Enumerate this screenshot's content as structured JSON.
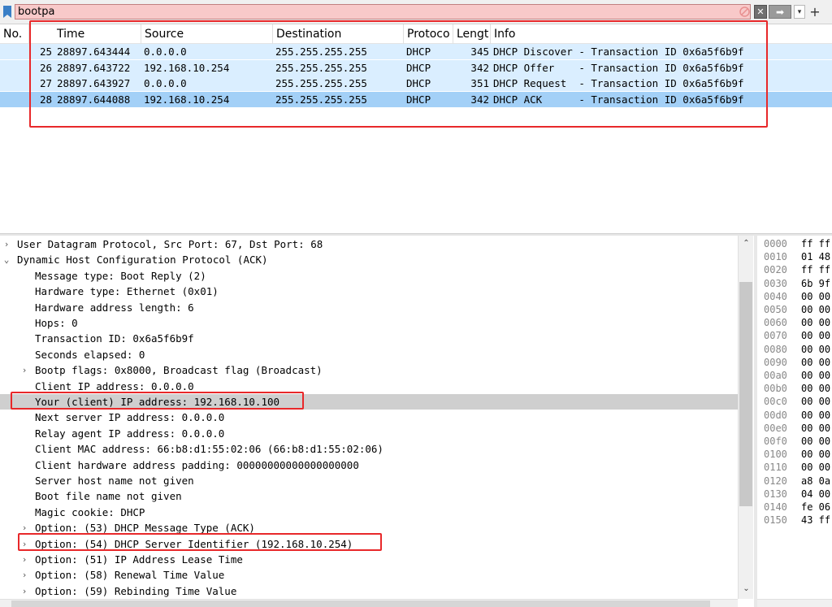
{
  "filter": {
    "text": "bootpa",
    "icons": {
      "bookmark": "bookmark-icon",
      "clear": "clear-filter-icon",
      "close": "close-icon",
      "apply": "arrow-right-icon",
      "dropdown": "chevron-down-icon",
      "add": "plus-icon"
    },
    "close_glyph": "✕",
    "apply_glyph": "➡",
    "dropdown_glyph": "▾",
    "add_glyph": "+"
  },
  "packet_list": {
    "columns": [
      "No.",
      "Time",
      "Source",
      "Destination",
      "Protoco",
      "Lengt",
      "Info"
    ],
    "rows": [
      {
        "no": "25",
        "time": "28897.643444",
        "src": "0.0.0.0",
        "dst": "255.255.255.255",
        "proto": "DHCP",
        "len": "345",
        "info": "DHCP Discover - Transaction ID 0x6a5f6b9f"
      },
      {
        "no": "26",
        "time": "28897.643722",
        "src": "192.168.10.254",
        "dst": "255.255.255.255",
        "proto": "DHCP",
        "len": "342",
        "info": "DHCP Offer    - Transaction ID 0x6a5f6b9f"
      },
      {
        "no": "27",
        "time": "28897.643927",
        "src": "0.0.0.0",
        "dst": "255.255.255.255",
        "proto": "DHCP",
        "len": "351",
        "info": "DHCP Request  - Transaction ID 0x6a5f6b9f"
      },
      {
        "no": "28",
        "time": "28897.644088",
        "src": "192.168.10.254",
        "dst": "255.255.255.255",
        "proto": "DHCP",
        "len": "342",
        "info": "DHCP ACK      - Transaction ID 0x6a5f6b9f"
      }
    ],
    "selected_no": "28"
  },
  "details": {
    "lines": [
      {
        "text": "User Datagram Protocol, Src Port: 67, Dst Port: 68",
        "arrow": "›",
        "level": 0
      },
      {
        "text": "Dynamic Host Configuration Protocol (ACK)",
        "arrow": "⌄",
        "level": 0
      },
      {
        "text": "Message type: Boot Reply (2)",
        "arrow": "",
        "level": 1
      },
      {
        "text": "Hardware type: Ethernet (0x01)",
        "arrow": "",
        "level": 1
      },
      {
        "text": "Hardware address length: 6",
        "arrow": "",
        "level": 1
      },
      {
        "text": "Hops: 0",
        "arrow": "",
        "level": 1
      },
      {
        "text": "Transaction ID: 0x6a5f6b9f",
        "arrow": "",
        "level": 1
      },
      {
        "text": "Seconds elapsed: 0",
        "arrow": "",
        "level": 1
      },
      {
        "text": "Bootp flags: 0x8000, Broadcast flag (Broadcast)",
        "arrow": "›",
        "level": 1
      },
      {
        "text": "Client IP address: 0.0.0.0",
        "arrow": "",
        "level": 1
      },
      {
        "text": "Your (client) IP address: 192.168.10.100",
        "arrow": "",
        "level": 1,
        "selected": true
      },
      {
        "text": "Next server IP address: 0.0.0.0",
        "arrow": "",
        "level": 1
      },
      {
        "text": "Relay agent IP address: 0.0.0.0",
        "arrow": "",
        "level": 1
      },
      {
        "text": "Client MAC address: 66:b8:d1:55:02:06 (66:b8:d1:55:02:06)",
        "arrow": "",
        "level": 1
      },
      {
        "text": "Client hardware address padding: 00000000000000000000",
        "arrow": "",
        "level": 1
      },
      {
        "text": "Server host name not given",
        "arrow": "",
        "level": 1
      },
      {
        "text": "Boot file name not given",
        "arrow": "",
        "level": 1
      },
      {
        "text": "Magic cookie: DHCP",
        "arrow": "",
        "level": 1
      },
      {
        "text": "Option: (53) DHCP Message Type (ACK)",
        "arrow": "›",
        "level": 1
      },
      {
        "text": "Option: (54) DHCP Server Identifier (192.168.10.254)",
        "arrow": "›",
        "level": 1
      },
      {
        "text": "Option: (51) IP Address Lease Time",
        "arrow": "›",
        "level": 1
      },
      {
        "text": "Option: (58) Renewal Time Value",
        "arrow": "›",
        "level": 1
      },
      {
        "text": "Option: (59) Rebinding Time Value",
        "arrow": "›",
        "level": 1
      }
    ],
    "scroll_up_glyph": "⌃",
    "scroll_down_glyph": "⌄",
    "scroll_left_glyph": "‹",
    "scroll_right_glyph": "›"
  },
  "bytes": {
    "rows": [
      {
        "offset": "0000",
        "hex": "ff ff"
      },
      {
        "offset": "0010",
        "hex": "01 48"
      },
      {
        "offset": "0020",
        "hex": "ff ff"
      },
      {
        "offset": "0030",
        "hex": "6b 9f"
      },
      {
        "offset": "0040",
        "hex": "00 00"
      },
      {
        "offset": "0050",
        "hex": "00 00"
      },
      {
        "offset": "0060",
        "hex": "00 00"
      },
      {
        "offset": "0070",
        "hex": "00 00"
      },
      {
        "offset": "0080",
        "hex": "00 00"
      },
      {
        "offset": "0090",
        "hex": "00 00"
      },
      {
        "offset": "00a0",
        "hex": "00 00"
      },
      {
        "offset": "00b0",
        "hex": "00 00"
      },
      {
        "offset": "00c0",
        "hex": "00 00"
      },
      {
        "offset": "00d0",
        "hex": "00 00"
      },
      {
        "offset": "00e0",
        "hex": "00 00"
      },
      {
        "offset": "00f0",
        "hex": "00 00"
      },
      {
        "offset": "0100",
        "hex": "00 00"
      },
      {
        "offset": "0110",
        "hex": "00 00"
      },
      {
        "offset": "0120",
        "hex": "a8 0a"
      },
      {
        "offset": "0130",
        "hex": "04 00"
      },
      {
        "offset": "0140",
        "hex": "fe 06"
      },
      {
        "offset": "0150",
        "hex": "43 ff"
      }
    ]
  },
  "colors": {
    "row_normal": "#daeeff",
    "row_selected": "#a3d0f7",
    "filter_bg": "#f8c9c9",
    "annotation": "#e8282a",
    "detail_selected": "#cfcfcf"
  }
}
